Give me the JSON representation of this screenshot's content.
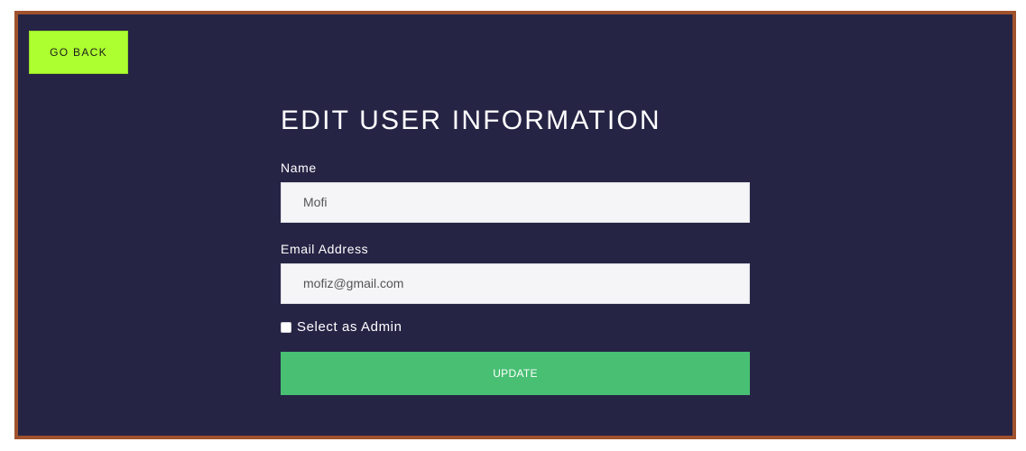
{
  "nav": {
    "go_back_label": "GO BACK"
  },
  "form": {
    "title": "EDIT USER INFORMATION",
    "name_label": "Name",
    "name_value": "Mofi",
    "email_label": "Email Address",
    "email_value": "mofiz@gmail.com",
    "admin_label": "Select as Admin",
    "admin_checked": false,
    "update_label": "UPDATE"
  },
  "colors": {
    "frame_border": "#a0522d",
    "background": "#262445",
    "go_back_bg": "#adff2f",
    "update_bg": "#48bf73",
    "input_bg": "#f5f5f8"
  }
}
